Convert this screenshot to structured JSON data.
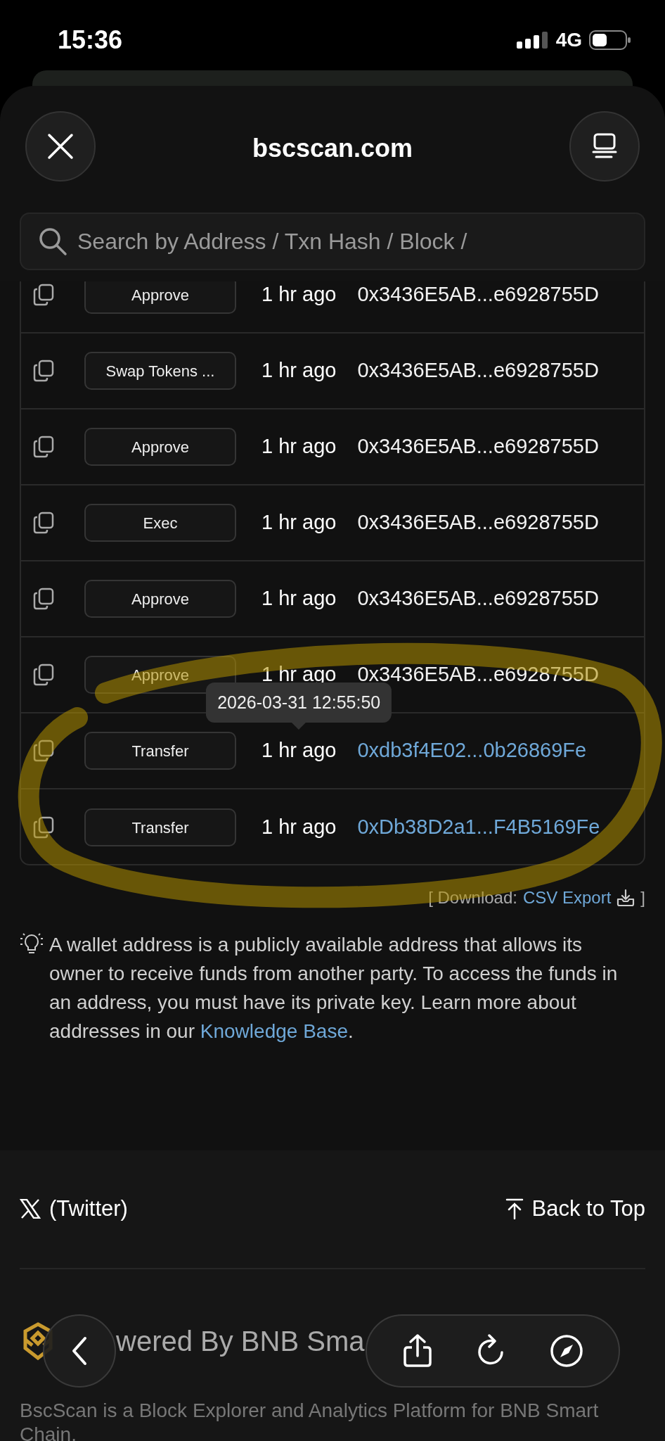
{
  "status_bar": {
    "time": "15:36",
    "network": "4G"
  },
  "browser": {
    "title": "bscscan.com",
    "search": {
      "placeholder": "Search by Address / Txn Hash / Block /"
    }
  },
  "transactions": {
    "rows": [
      {
        "method": "Approve",
        "age": "1 hr ago",
        "address": "0x3436E5AB...e6928755D",
        "link": false
      },
      {
        "method": "Swap Tokens ...",
        "age": "1 hr ago",
        "address": "0x3436E5AB...e6928755D",
        "link": false
      },
      {
        "method": "Approve",
        "age": "1 hr ago",
        "address": "0x3436E5AB...e6928755D",
        "link": false
      },
      {
        "method": "Exec",
        "age": "1 hr ago",
        "address": "0x3436E5AB...e6928755D",
        "link": false
      },
      {
        "method": "Approve",
        "age": "1 hr ago",
        "address": "0x3436E5AB...e6928755D",
        "link": false
      },
      {
        "method": "Approve",
        "age": "1 hr ago",
        "address": "0x3436E5AB...e6928755D",
        "link": false
      },
      {
        "method": "Transfer",
        "age": "1 hr ago",
        "address": "0xdb3f4E02...0b26869Fe",
        "link": true,
        "tooltip": "2026-03-31 12:55:50"
      },
      {
        "method": "Transfer",
        "age": "1 hr ago",
        "address": "0xDb38D2a1...F4B5169Fe",
        "link": true
      }
    ]
  },
  "download": {
    "prefix": "[ Download:",
    "link": "CSV Export",
    "suffix": "]"
  },
  "info": {
    "text": "A wallet address is a publicly available address that allows its owner to receive funds from another party. To access the funds in an address, you must have its private key. Learn more about addresses in our ",
    "link": "Knowledge Base",
    "after": "."
  },
  "footer": {
    "twitter": "(Twitter)",
    "back_to_top": "Back to Top",
    "powered": "wered By BNB Sma",
    "description": "BscScan is a Block Explorer and Analytics Platform for BNB Smart Chain."
  }
}
